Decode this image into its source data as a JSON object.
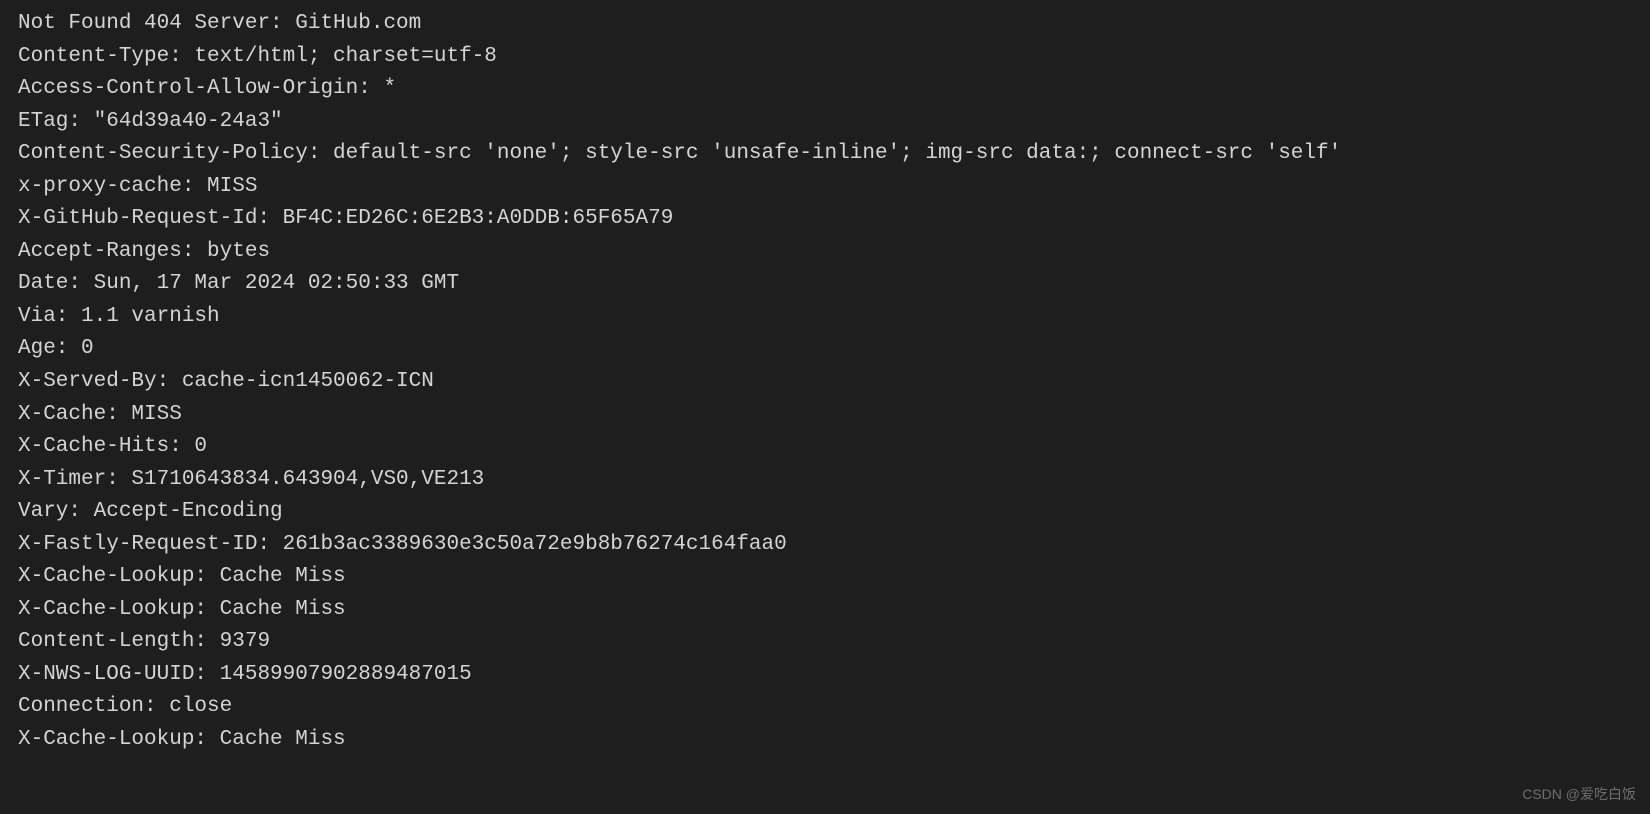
{
  "lines": [
    "Not Found 404 Server: GitHub.com",
    "Content-Type: text/html; charset=utf-8",
    "Access-Control-Allow-Origin: *",
    "ETag: \"64d39a40-24a3\"",
    "Content-Security-Policy: default-src 'none'; style-src 'unsafe-inline'; img-src data:; connect-src 'self'",
    "x-proxy-cache: MISS",
    "X-GitHub-Request-Id: BF4C:ED26C:6E2B3:A0DDB:65F65A79",
    "Accept-Ranges: bytes",
    "Date: Sun, 17 Mar 2024 02:50:33 GMT",
    "Via: 1.1 varnish",
    "Age: 0",
    "X-Served-By: cache-icn1450062-ICN",
    "X-Cache: MISS",
    "X-Cache-Hits: 0",
    "X-Timer: S1710643834.643904,VS0,VE213",
    "Vary: Accept-Encoding",
    "X-Fastly-Request-ID: 261b3ac3389630e3c50a72e9b8b76274c164faa0",
    "X-Cache-Lookup: Cache Miss",
    "X-Cache-Lookup: Cache Miss",
    "Content-Length: 9379",
    "X-NWS-LOG-UUID: 14589907902889487015",
    "Connection: close",
    "X-Cache-Lookup: Cache Miss"
  ],
  "watermark": "CSDN @爱吃白饭"
}
